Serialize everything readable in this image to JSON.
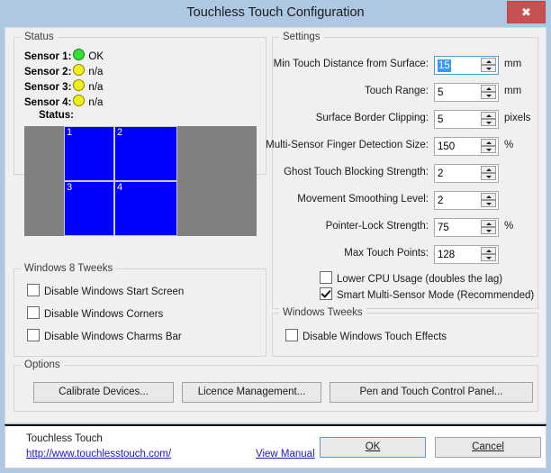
{
  "window": {
    "title": "Touchless Touch Configuration",
    "close_icon": "close-icon",
    "close_glyph": "✖"
  },
  "status": {
    "legend": "Status",
    "sensors": [
      {
        "label": "Sensor 1:",
        "state": "OK",
        "led": "green"
      },
      {
        "label": "Sensor 2:",
        "state": "n/a",
        "led": "yellow"
      },
      {
        "label": "Sensor 3:",
        "state": "n/a",
        "led": "yellow"
      },
      {
        "label": "Sensor 4:",
        "state": "n/a",
        "led": "yellow"
      }
    ],
    "sub_label": "Status:",
    "map": {
      "background_color": "#808080",
      "quadrant_color": "#0000ff",
      "quadrants": [
        "1",
        "2",
        "3",
        "4"
      ]
    }
  },
  "settings": {
    "legend": "Settings",
    "rows": [
      {
        "label": "Min Touch Distance from Surface:",
        "value": "15",
        "unit": "mm",
        "focused": true
      },
      {
        "label": "Touch Range:",
        "value": "5",
        "unit": "mm",
        "focused": false
      },
      {
        "label": "Surface Border Clipping:",
        "value": "5",
        "unit": "pixels",
        "focused": false
      },
      {
        "label": "Multi-Sensor Finger Detection Size:",
        "value": "150",
        "unit": "%",
        "focused": false
      },
      {
        "label": "Ghost Touch Blocking Strength:",
        "value": "2",
        "unit": "",
        "focused": false
      },
      {
        "label": "Movement Smoothing Level:",
        "value": "2",
        "unit": "",
        "focused": false
      },
      {
        "label": "Pointer-Lock Strength:",
        "value": "75",
        "unit": "%",
        "focused": false
      },
      {
        "label": "Max Touch Points:",
        "value": "128",
        "unit": "",
        "focused": false
      }
    ],
    "checkboxes": [
      {
        "label": "Lower CPU Usage (doubles the lag)",
        "checked": false
      },
      {
        "label": "Smart Multi-Sensor Mode (Recommended)",
        "checked": true
      }
    ]
  },
  "windows8_tweaks": {
    "legend": "Windows 8 Tweeks",
    "checkboxes": [
      {
        "label": "Disable Windows Start Screen",
        "checked": false
      },
      {
        "label": "Disable Windows Corners",
        "checked": false
      },
      {
        "label": "Disable Windows Charms Bar",
        "checked": false
      }
    ]
  },
  "windows_tweeks": {
    "legend": "Windows Tweeks",
    "checkboxes": [
      {
        "label": "Disable Windows Touch Effects",
        "checked": false
      }
    ]
  },
  "options": {
    "legend": "Options",
    "buttons": [
      {
        "label": "Calibrate Devices..."
      },
      {
        "label": "Licence Management..."
      },
      {
        "label": "Pen and Touch Control Panel..."
      }
    ]
  },
  "footer": {
    "product_name": "Touchless Touch",
    "url": "http://www.touchlesstouch.com/",
    "manual_link": "View Manual",
    "ok_label": "OK",
    "ok_mnemonic": "O",
    "cancel_label": "Cancel",
    "cancel_mnemonic": "C"
  },
  "colors": {
    "titlebar": "#aec8e4",
    "client": "#f0f0f0",
    "close_button": "#c75050",
    "accent_focus": "#4f9fd6",
    "selection": "#3399ff",
    "link": "#1818c8",
    "sensor_blue": "#0000ff",
    "sensor_gray": "#808080",
    "led_ok": "#33e033",
    "led_na": "#f2ee18"
  }
}
